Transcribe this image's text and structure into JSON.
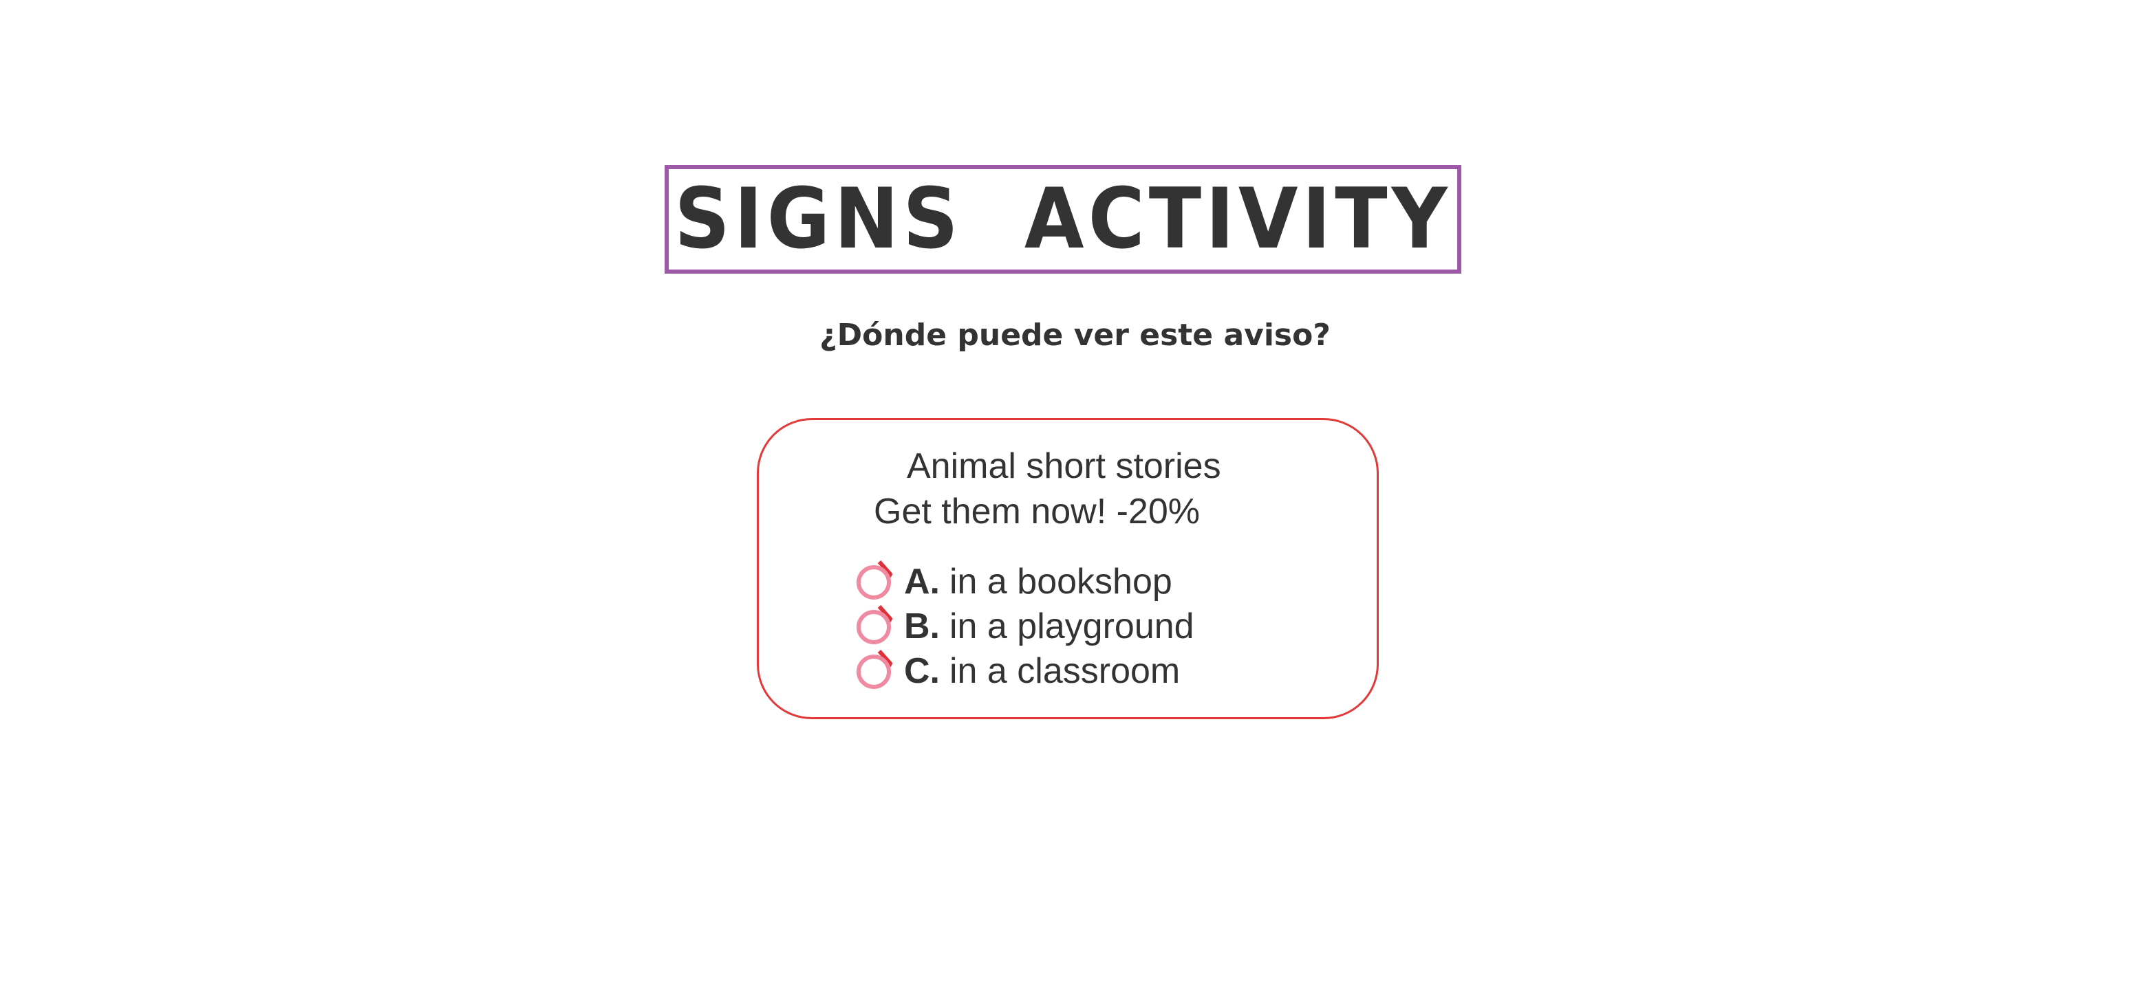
{
  "title": "SIGNS  ACTIVITY",
  "question": "¿Dónde puede ver este aviso?",
  "sign": {
    "line1": "Animal short stories",
    "line2": "Get them now! -20%"
  },
  "options": [
    {
      "letter": "A.",
      "text": "in a bookshop"
    },
    {
      "letter": "B.",
      "text": "in a playground"
    },
    {
      "letter": "C.",
      "text": "in a classroom"
    }
  ],
  "colors": {
    "title_border": "#9b59a6",
    "card_border": "#e03a3a",
    "radio_ring": "#f08aa0",
    "radio_accent": "#e0303a",
    "text": "#333333"
  },
  "icons": {
    "radio": "radio-circle-icon"
  }
}
